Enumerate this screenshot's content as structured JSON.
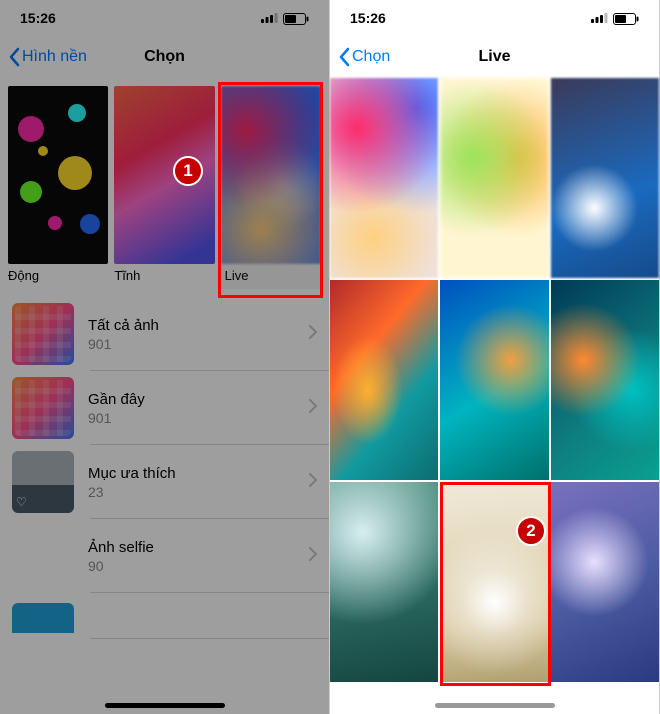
{
  "left": {
    "status": {
      "time": "15:26"
    },
    "nav": {
      "back": "Hình nền",
      "title": "Chọn"
    },
    "categories": {
      "dynamic": "Động",
      "still": "Tĩnh",
      "live": "Live"
    },
    "step1_badge": "1",
    "albums": [
      {
        "name": "Tất cả ảnh",
        "count": "901"
      },
      {
        "name": "Gần đây",
        "count": "901"
      },
      {
        "name": "Mục ưa thích",
        "count": "23"
      },
      {
        "name": "Ảnh selfie",
        "count": "90"
      }
    ]
  },
  "right": {
    "status": {
      "time": "15:26"
    },
    "nav": {
      "back": "Chọn",
      "title": "Live"
    },
    "step2_badge": "2"
  }
}
